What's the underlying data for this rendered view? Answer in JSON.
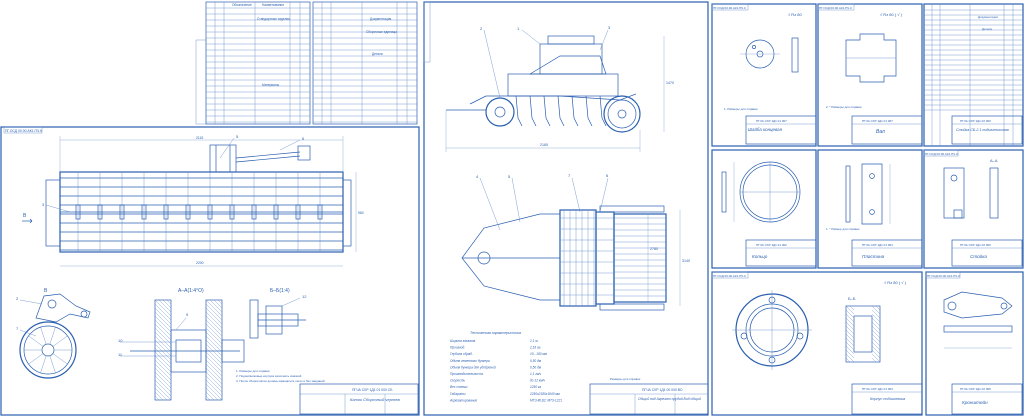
{
  "colors": {
    "line": "#2a5fb0",
    "paper": "#ffffff"
  },
  "sheets": {
    "frame_code_a": "ПГ.ОСД 00.00.АК1.ПЧ.К",
    "frame_code_b": "ПГ.ОСД 00.00.АК1.ПЧ.К",
    "frame_code_c": "ПГ.ОСД 00.00.АК1.ПЧ.К",
    "frame_code_d": "ПГ.ОСД 00.00.АК1.ПЧ.К",
    "frame_code_e": "ПГ.ОСД 00.00.АК1.ПЧ.К",
    "frame_code_f": "ПГ.ОСД 00.00.АК1.ПЧ.К",
    "frame_code_g": "ПГ.ОСД 00.00.АК1.ПЧ.К",
    "frame_code_h": "ПГ.ОСД 00.00.АК1.ПЧ.К",
    "main_assembly_title": "Каток\nСборочный чертеж",
    "main_assembly_code": "ПГЧА СХР 1Д1 01 000 СБ",
    "general_view_title": "Общий вид\nАгрегат орудий\nВид общий",
    "general_view_code": "ПГЧА СХР 1Д1 00 000 ВО",
    "part_shaiba": "Шайба концевая",
    "part_shaiba_code": "ПГЧА СХР 1Д1 01 007",
    "part_val": "Вал",
    "part_val_code": "ПГЧА СХР 1Д1 01 007",
    "part_stoika_asm": "Стойка СБ-2.1\nподшипниковая",
    "part_stoika_asm_code": "ПГЧА СХР 1Д1 02 000",
    "part_kolco": "Кольцо",
    "part_kolco_code": "ПГЧА СХР 1Д1 01 002",
    "part_plastina": "Пластина",
    "part_plastina_code": "ПГЧА СХР 1Д1 01 004",
    "part_stoika": "Стойка",
    "part_stoika_code": "ПГЧА СХР 1Д1 02 006",
    "part_korpus": "Корпус\nподшипника",
    "part_korpus_code": "ПГЧА СХР 1Д1 01 003",
    "part_kronshtein": "Кронштейн",
    "part_kronshtein_code": "ПГЧА СХР 1Д1 02 005"
  },
  "spec_table_1": {
    "header_a": "Обозначение",
    "header_b": "Наименование",
    "section_1": "Стандартные изделия",
    "section_2": "Материалы"
  },
  "spec_table_2": {
    "section_1": "Документация",
    "section_2": "Сборочные единицы",
    "section_3": "Детали"
  },
  "spec_table_3": {
    "section_1": "Документация",
    "section_2": "Детали"
  },
  "views": {
    "section_aa": "А–А(1:4°О)",
    "section_bb": "Б–Б(1:4)",
    "view_b": "В",
    "view_aa_small": "А–А",
    "view_bb_small": "Б–Б",
    "rough_1": "√ Rz 80",
    "rough_2": "√ Rz 80 ( √ )",
    "rough_3": "√ Rz 80 ( √ )"
  },
  "general_view": {
    "dim_len": "2165",
    "dim_height": "1470",
    "dim_width": "2780",
    "dim_plan_width": "3140",
    "tech_title": "Техническая характеристика",
    "tech_rows": [
      {
        "k": "Ширина захвата",
        "v": "2,1 м"
      },
      {
        "k": "Производ.",
        "v": "2,16 га"
      },
      {
        "k": "Глубина обраб.",
        "v": "10...160 мм"
      },
      {
        "k": "Объем семенного бункера",
        "v": "0,50 дм"
      },
      {
        "k": "Объем бункера для удобрений",
        "v": "0,50 дм"
      },
      {
        "k": "Производительность",
        "v": "1,1 га/ч"
      },
      {
        "k": "Скорость",
        "v": "до 12 км/ч"
      },
      {
        "k": "Вес стенки",
        "v": "1250 кг"
      },
      {
        "k": "Габариты",
        "v": "2250х2180х1840 мм"
      },
      {
        "k": "Агрегатирование",
        "v": "МТЗ-80,82; МТЗ-1221"
      }
    ],
    "note": "Размеры для справок"
  },
  "notes_main": [
    "1. Размеры для справок",
    "2. Подшипниковые корпуса заполнить смазкой",
    "3. После сборки катки должны вращаться легко и без заеданий"
  ],
  "part_notes": {
    "n1": "1. Размеры для справок",
    "n2": "2. * Размеры для справок",
    "n3": "1. * Размер для справок"
  },
  "callouts": [
    "1",
    "2",
    "3",
    "4",
    "5",
    "6",
    "7",
    "8",
    "9",
    "10",
    "11",
    "12"
  ]
}
